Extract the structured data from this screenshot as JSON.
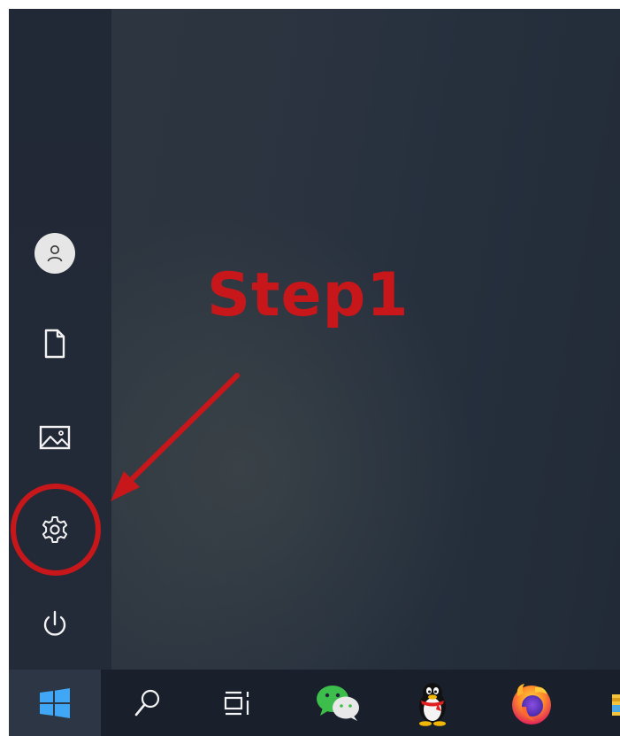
{
  "annotation": {
    "step_label": "Step1",
    "color": "#c8171b"
  },
  "start_menu": {
    "rail": [
      {
        "name": "avatar",
        "icon": "user-avatar-icon"
      },
      {
        "name": "documents",
        "icon": "document-icon"
      },
      {
        "name": "pictures",
        "icon": "picture-icon"
      },
      {
        "name": "settings",
        "icon": "gear-icon",
        "highlighted": true
      },
      {
        "name": "power",
        "icon": "power-icon"
      }
    ]
  },
  "taskbar": {
    "items": [
      {
        "name": "start",
        "icon": "windows-logo-icon"
      },
      {
        "name": "search",
        "icon": "search-icon"
      },
      {
        "name": "task-view",
        "icon": "task-view-icon"
      },
      {
        "name": "wechat",
        "icon": "wechat-icon"
      },
      {
        "name": "qq",
        "icon": "qq-penguin-icon"
      },
      {
        "name": "firefox",
        "icon": "firefox-icon"
      },
      {
        "name": "file-explorer",
        "icon": "folder-icon"
      }
    ]
  }
}
